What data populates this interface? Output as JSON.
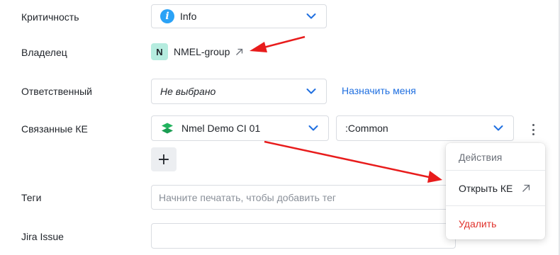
{
  "fields": {
    "criticality": {
      "label": "Критичность",
      "value": "Info",
      "icon": "info-icon"
    },
    "owner": {
      "label": "Владелец",
      "avatar_letter": "N",
      "name": "NMEL-group",
      "avatar_color": "#b5ecdf"
    },
    "responsible": {
      "label": "Ответственный",
      "value": "Не выбрано",
      "assign_link": "Назначить меня"
    },
    "linked_ke": {
      "label": "Связанные КЕ",
      "value": "Nmel Demo CI 01",
      "second_value": ":Common",
      "add_button": "+"
    },
    "tags": {
      "label": "Теги",
      "placeholder": "Начните печатать, чтобы добавить тег"
    },
    "jira": {
      "label": "Jira Issue",
      "value": ""
    }
  },
  "actions_menu": {
    "header": "Действия",
    "open_item": "Открыть КЕ",
    "delete_item": "Удалить"
  },
  "colors": {
    "accent_link": "#1f6fe0",
    "danger": "#e0312b",
    "annotation_arrow": "#e81c1c",
    "info_icon": "#2aa2f6",
    "layers_icon": "#22b35e"
  }
}
